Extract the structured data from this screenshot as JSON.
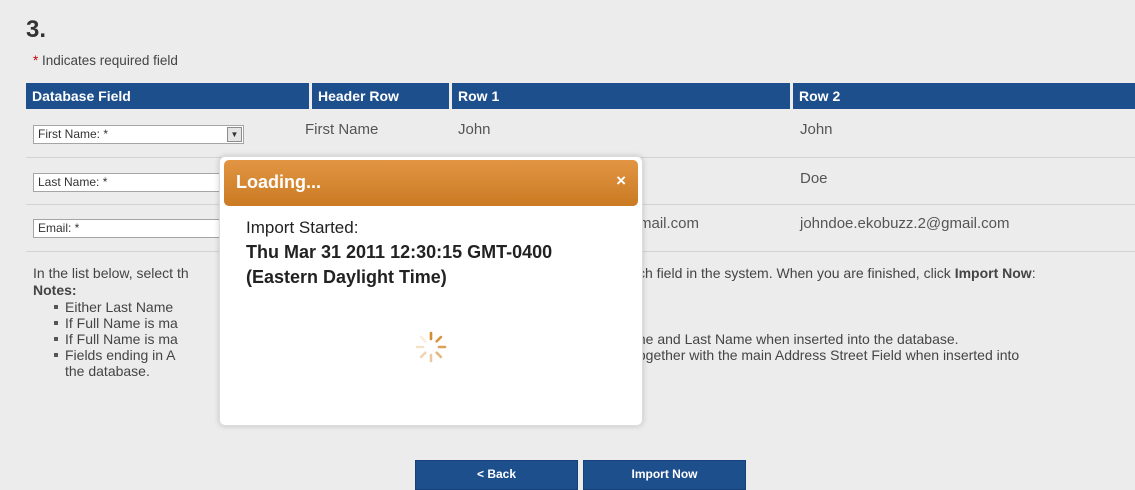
{
  "step_number": "3.",
  "required_note": {
    "star": "*",
    "text": " Indicates required field"
  },
  "grid": {
    "headers": [
      "Database Field",
      "Header Row",
      "Row 1",
      "Row 2"
    ],
    "rows": [
      {
        "field": "First Name: *",
        "header": "First Name",
        "row1": "John",
        "row2": "John"
      },
      {
        "field": "Last Name: *",
        "header": "",
        "row1": "",
        "row2": "Doe"
      },
      {
        "field": "Email: *",
        "header": "",
        "row1": "mail.com",
        "row2": "johndoe.ekobuzz.2@gmail.com"
      }
    ]
  },
  "instructions": {
    "left": "In the list below, select th",
    "right": "ch field in the system. When you are finished, click",
    "right_bold": "Import Now",
    "right_end": ":",
    "notes_label": "Notes:",
    "notes": [
      {
        "left": "Either Last Name",
        "right": ""
      },
      {
        "left": "If Full Name is ma",
        "right": ""
      },
      {
        "left": "If Full Name is ma",
        "right": "me and Last Name when inserted into the database."
      },
      {
        "left": "Fields ending in A",
        "right": "together with the main Address Street Field when inserted into"
      }
    ],
    "note_tail": "the database."
  },
  "buttons": {
    "back": "< Back",
    "import": "Import Now"
  },
  "modal": {
    "title": "Loading...",
    "close": "×",
    "label": "Import Started:",
    "time_line1": "Thu Mar 31 2011 12:30:15 GMT-0400",
    "time_line2": "(Eastern Daylight Time)"
  },
  "colors": {
    "header_blue": "#1e4f8d",
    "modal_orange": "#d7893a",
    "required_red": "#cc0000"
  },
  "icons": {
    "close": "close-icon",
    "dropdown": "chevron-down-icon",
    "spinner": "loading-spinner-icon"
  }
}
